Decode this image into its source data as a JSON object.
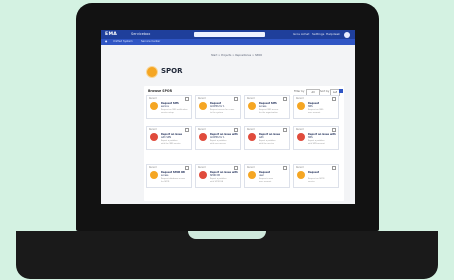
{
  "app": {
    "logo": "EMA",
    "name": "Servicebox",
    "menu": [
      "Gros Achat",
      "Settings",
      "Helpdesk"
    ]
  },
  "subnav": [
    "Unified System",
    "Service Center"
  ],
  "breadcrumb": "Start  >  Projects  >  Repositories  >  SPOR",
  "page": {
    "title": "SPOR"
  },
  "panel": {
    "title": "Browse SPOR",
    "filter_label": "Filter by",
    "filter_value": "All",
    "sort_label": "Sort by",
    "sort_value": "A-Z"
  },
  "cards": [
    {
      "tag": "Recent",
      "title": "Request SMS",
      "title2": "service",
      "sub1": "Request an SMS notification",
      "sub2": "service setup",
      "color": "#f5a623"
    },
    {
      "tag": "Recent",
      "title": "Request",
      "title2": "ACCESS for 1",
      "sub1": "Request access for a user",
      "sub2": "to the system",
      "color": "#f5a623"
    },
    {
      "tag": "Recent",
      "title": "Request SMS",
      "title2": "access",
      "sub1": "Request SMS access",
      "sub2": "for the organisation",
      "color": "#f5a623"
    },
    {
      "tag": "Recent",
      "title": "Request",
      "title2": "SMS",
      "sub1": "Request an SMS",
      "sub2": "user account",
      "color": "#f5a623"
    },
    {
      "tag": "Recent",
      "title": "Report an issue",
      "title2": "with SMS",
      "sub1": "Report a problem",
      "sub2": "with the SMS service",
      "color": "#e04b3c"
    },
    {
      "tag": "Recent",
      "title": "Report an issue with",
      "title2": "ACCESS for 1",
      "sub1": "Report a problem",
      "sub2": "with user access",
      "color": "#e04b3c"
    },
    {
      "tag": "Recent",
      "title": "Report an issue",
      "title2": "with",
      "sub1": "Report a problem",
      "sub2": "with the service",
      "color": "#e04b3c"
    },
    {
      "tag": "Recent",
      "title": "Report an issue with",
      "title2": "SMS",
      "sub1": "Report a problem",
      "sub2": "with SMS account",
      "color": "#e04b3c"
    },
    {
      "tag": "Recent",
      "title": "Request SPOR DB",
      "title2": "access",
      "sub1": "Request database access",
      "sub2": "for SPOR",
      "color": "#f5a623"
    },
    {
      "tag": "Recent",
      "title": "Report an issue with",
      "title2": "SPOR DB",
      "sub1": "Report a problem",
      "sub2": "with SPOR DB",
      "color": "#e04b3c"
    },
    {
      "tag": "Recent",
      "title": "Request",
      "title2": "user",
      "sub1": "Request a new",
      "sub2": "user account",
      "color": "#f5a623"
    },
    {
      "tag": "Recent",
      "title": "Request",
      "title2": "",
      "sub1": "Request an SPOR",
      "sub2": "service",
      "color": "#f5a623"
    }
  ]
}
